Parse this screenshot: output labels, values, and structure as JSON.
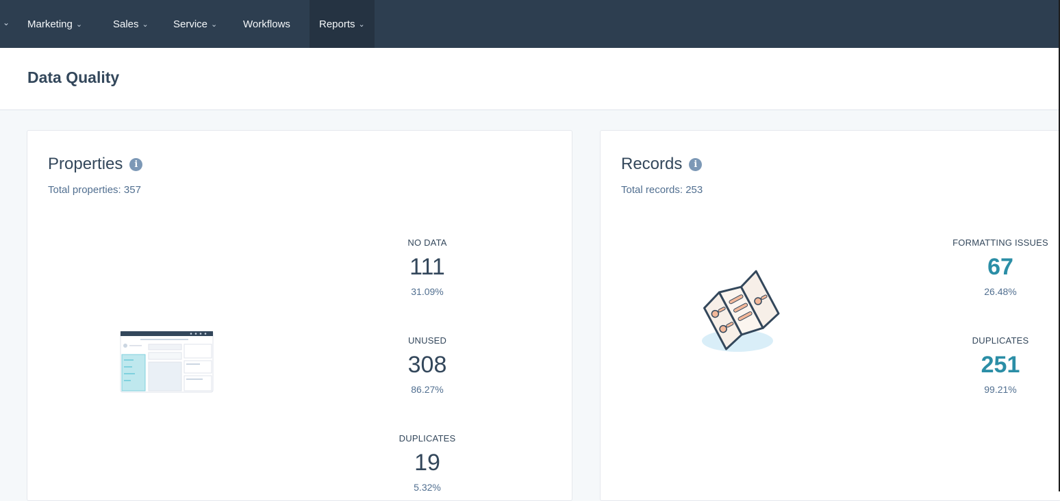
{
  "nav": {
    "items": [
      {
        "label": "Marketing",
        "has_dropdown": true
      },
      {
        "label": "Sales",
        "has_dropdown": true
      },
      {
        "label": "Service",
        "has_dropdown": true
      },
      {
        "label": "Workflows",
        "has_dropdown": false
      },
      {
        "label": "Reports",
        "has_dropdown": true,
        "active": true
      }
    ]
  },
  "page": {
    "title": "Data Quality"
  },
  "properties": {
    "title": "Properties",
    "subtitle": "Total properties: 357",
    "stats": [
      {
        "label": "NO DATA",
        "value": "111",
        "percent": "31.09%"
      },
      {
        "label": "UNUSED",
        "value": "308",
        "percent": "86.27%"
      },
      {
        "label": "DUPLICATES",
        "value": "19",
        "percent": "5.32%"
      }
    ]
  },
  "records": {
    "title": "Records",
    "subtitle": "Total records: 253",
    "stats": [
      {
        "label": "FORMATTING ISSUES",
        "value": "67",
        "percent": "26.48%"
      },
      {
        "label": "DUPLICATES",
        "value": "251",
        "percent": "99.21%"
      }
    ]
  },
  "colors": {
    "nav_bg": "#2d3e50",
    "accent_teal": "#2b8ea6",
    "info_icon": "#7c98b6"
  }
}
